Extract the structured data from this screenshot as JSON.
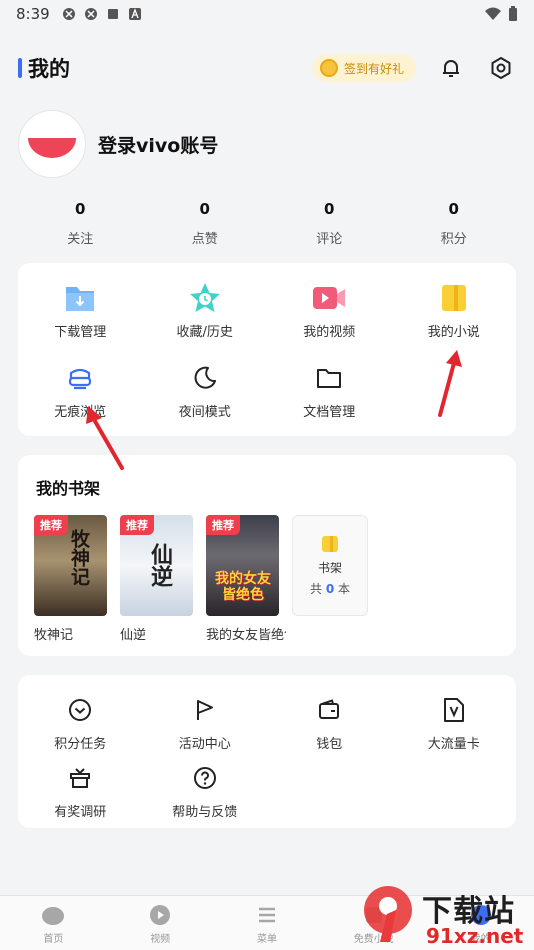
{
  "status": {
    "time": "8:39"
  },
  "header": {
    "title": "我的",
    "checkin_label": "签到有好礼"
  },
  "profile": {
    "login_label": "登录vivo账号"
  },
  "stats": [
    {
      "value": "0",
      "label": "关注"
    },
    {
      "value": "0",
      "label": "点赞"
    },
    {
      "value": "0",
      "label": "评论"
    },
    {
      "value": "0",
      "label": "积分"
    }
  ],
  "tools": [
    {
      "label": "下载管理",
      "icon": "download-folder-icon"
    },
    {
      "label": "收藏/历史",
      "icon": "star-history-icon"
    },
    {
      "label": "我的视频",
      "icon": "video-icon"
    },
    {
      "label": "我的小说",
      "icon": "novel-book-icon"
    },
    {
      "label": "无痕浏览",
      "icon": "incognito-icon"
    },
    {
      "label": "夜间模式",
      "icon": "moon-icon"
    },
    {
      "label": "文档管理",
      "icon": "folder-icon"
    }
  ],
  "bookshelf": {
    "title": "我的书架",
    "tag": "推荐",
    "books": [
      {
        "name": "牧神记",
        "cover_text": "牧神记"
      },
      {
        "name": "仙逆",
        "cover_text": "仙逆"
      },
      {
        "name": "我的女友皆绝色",
        "cover_text": "我的女友皆绝色"
      }
    ],
    "shelf_label": "书架",
    "count_prefix": "共",
    "count": "0",
    "count_suffix": "本"
  },
  "services": [
    {
      "label": "积分任务",
      "icon": "check-circle-icon"
    },
    {
      "label": "活动中心",
      "icon": "flag-icon"
    },
    {
      "label": "钱包",
      "icon": "wallet-icon"
    },
    {
      "label": "大流量卡",
      "icon": "sim-card-icon"
    },
    {
      "label": "有奖调研",
      "icon": "gift-icon"
    },
    {
      "label": "帮助与反馈",
      "icon": "help-icon"
    }
  ],
  "nav": [
    {
      "label": "首页",
      "icon": "home-icon"
    },
    {
      "label": "视频",
      "icon": "play-icon"
    },
    {
      "label": "菜单",
      "icon": "menu-icon"
    },
    {
      "label": "免费小说",
      "icon": "book-icon"
    },
    {
      "label": "我的",
      "icon": "profile-icon"
    }
  ],
  "watermark": {
    "brand": "下载站",
    "domain": "91xz.net",
    "number": "9"
  },
  "colors": {
    "accent": "#3b6ef5",
    "tag_red": "#ee3f4d",
    "arrow_red": "#e0262f"
  }
}
